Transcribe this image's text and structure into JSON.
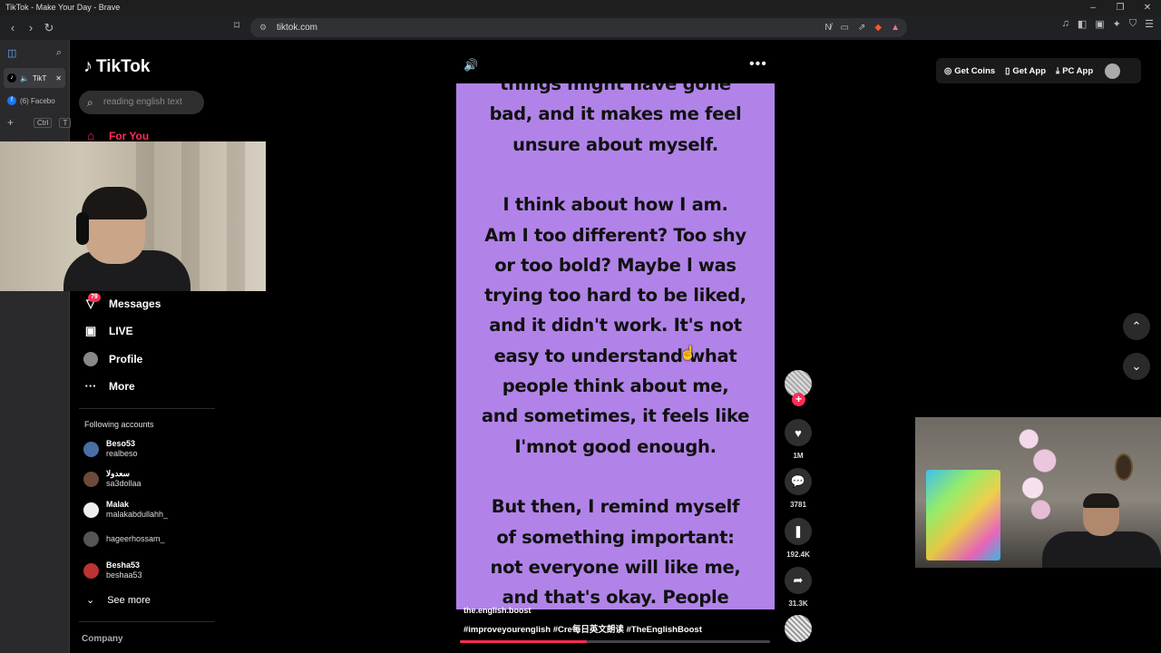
{
  "window": {
    "title": "TikTok - Make Your Day - Brave",
    "controls": [
      "–",
      "❐",
      "✕"
    ]
  },
  "browser": {
    "url": "tiktok.com",
    "tabs": [
      {
        "label": "TikT",
        "active": true,
        "favicon": "tiktok"
      },
      {
        "label": "(6) Facebo",
        "active": false,
        "favicon": "facebook"
      }
    ],
    "new_tab": {
      "plus": "+",
      "kb1": "Ctrl",
      "kb2": "T"
    }
  },
  "tiktok": {
    "logo": "TikTok",
    "search_placeholder": "reading english text",
    "nav": {
      "for_you": "For You",
      "messages": "Messages",
      "messages_badge": "79",
      "live": "LIVE",
      "profile": "Profile",
      "more": "More"
    },
    "following_header": "Following accounts",
    "accounts": [
      {
        "name": "Beso53",
        "username": "realbeso"
      },
      {
        "name": "سعدولا",
        "username": "sa3dollaa"
      },
      {
        "name": "Malak",
        "username": "malakabdullahh_"
      },
      {
        "name": "",
        "username": "hageerhossam_"
      },
      {
        "name": "Besha53",
        "username": "beshaa53"
      }
    ],
    "see_more": "See more",
    "company": "Company",
    "top_buttons": {
      "get_coins": "Get Coins",
      "get_app": "Get App",
      "pc_app": "PC App"
    },
    "video": {
      "lines": [
        "things might have gone",
        "bad, and it makes me feel",
        "unsure about myself.",
        "",
        "I think about how I am.",
        "Am I too different? Too shy",
        "or too bold? Maybe l was",
        "trying too hard to be liked,",
        "and it didn't work. It's not",
        "easy to understand what",
        "people think about me,",
        "and sometimes, it feels like",
        "I'mnot good enough.",
        "",
        "But then, I remind myself",
        "of something important:",
        "not everyone will like me,",
        "and that's okay. People"
      ],
      "author": "the.english.boost",
      "hashtags": "#improveyourenglish  #Cre每日英文朗读  #TheEnglishBoost",
      "progress_fraction": 0.41,
      "bg_color": "#b183e8"
    },
    "actions": {
      "likes": "1M",
      "comments": "3781",
      "saves": "192.4K",
      "shares": "31.3K"
    },
    "accent": "#fe2c55"
  }
}
